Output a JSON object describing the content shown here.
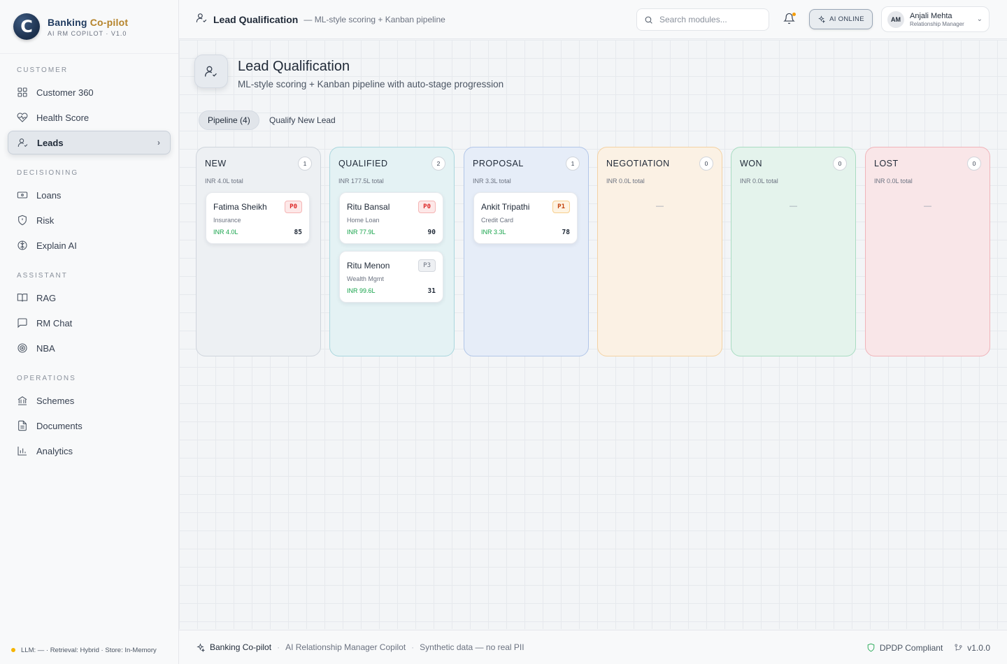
{
  "brand": {
    "name_main": "Banking ",
    "name_accent": "Co-pilot",
    "subtitle": "AI RM COPILOT · V1.0",
    "logo_letter": "C",
    "accent_color": "#b5832a"
  },
  "sidebar": {
    "sections": [
      {
        "title": "CUSTOMER",
        "items": [
          {
            "label": "Customer 360",
            "icon": "grid-icon"
          },
          {
            "label": "Health Score",
            "icon": "heart-pulse-icon"
          },
          {
            "label": "Leads",
            "icon": "user-check-icon",
            "active": true
          }
        ]
      },
      {
        "title": "DECISIONING",
        "items": [
          {
            "label": "Loans",
            "icon": "banknote-icon"
          },
          {
            "label": "Risk",
            "icon": "shield-icon"
          },
          {
            "label": "Explain AI",
            "icon": "brain-icon"
          }
        ]
      },
      {
        "title": "ASSISTANT",
        "items": [
          {
            "label": "RAG",
            "icon": "book-icon"
          },
          {
            "label": "RM Chat",
            "icon": "chat-icon"
          },
          {
            "label": "NBA",
            "icon": "target-icon"
          }
        ]
      },
      {
        "title": "OPERATIONS",
        "items": [
          {
            "label": "Schemes",
            "icon": "bank-icon"
          },
          {
            "label": "Documents",
            "icon": "document-icon"
          },
          {
            "label": "Analytics",
            "icon": "bar-chart-icon"
          }
        ]
      }
    ],
    "footer": "LLM: — · Retrieval: Hybrid · Store: In-Memory"
  },
  "topbar": {
    "title": "Lead Qualification",
    "subtitle": "— ML-style scoring + Kanban pipeline",
    "search_placeholder": "Search modules...",
    "ai_status": "AI ONLINE",
    "user": {
      "initials": "AM",
      "name": "Anjali Mehta",
      "role": "Relationship Manager"
    }
  },
  "page": {
    "title": "Lead Qualification",
    "subtitle": "ML-style scoring + Kanban pipeline with auto-stage progression",
    "tabs": [
      {
        "label": "Pipeline (4)",
        "active": true
      },
      {
        "label": "Qualify New Lead",
        "active": false
      }
    ]
  },
  "pipeline": {
    "columns": [
      {
        "name": "NEW",
        "count": "1",
        "total": "INR 4.0L total",
        "bg": "#edf0f3",
        "border": "#cfd5dc",
        "cards": [
          {
            "name": "Fatima Sheikh",
            "product": "Insurance",
            "amount": "INR 4.0L",
            "score": "85",
            "priority": "P0"
          }
        ]
      },
      {
        "name": "QUALIFIED",
        "count": "2",
        "total": "INR 177.5L total",
        "bg": "#e4f2f4",
        "border": "#aad7de",
        "cards": [
          {
            "name": "Ritu Bansal",
            "product": "Home Loan",
            "amount": "INR 77.9L",
            "score": "90",
            "priority": "P0"
          },
          {
            "name": "Ritu Menon",
            "product": "Wealth Mgmt",
            "amount": "INR 99.6L",
            "score": "31",
            "priority": "P3"
          }
        ]
      },
      {
        "name": "PROPOSAL",
        "count": "1",
        "total": "INR 3.3L total",
        "bg": "#e6edf8",
        "border": "#b2c6e8",
        "cards": [
          {
            "name": "Ankit Tripathi",
            "product": "Credit Card",
            "amount": "INR 3.3L",
            "score": "78",
            "priority": "P1"
          }
        ]
      },
      {
        "name": "NEGOTIATION",
        "count": "0",
        "total": "INR 0.0L total",
        "bg": "#fbf1e4",
        "border": "#f3d2a4",
        "cards": [],
        "empty": "—"
      },
      {
        "name": "WON",
        "count": "0",
        "total": "INR 0.0L total",
        "bg": "#e4f3ec",
        "border": "#a9dcc2",
        "cards": [],
        "empty": "—"
      },
      {
        "name": "LOST",
        "count": "0",
        "total": "INR 0.0L total",
        "bg": "#f9e6e8",
        "border": "#f0b4ba",
        "cards": [],
        "empty": "—"
      }
    ]
  },
  "footer": {
    "brand": "Banking Co-pilot",
    "tagline": "AI Relationship Manager Copilot",
    "note": "Synthetic data — no real PII",
    "compliance": "DPDP Compliant",
    "version": "v1.0.0"
  }
}
